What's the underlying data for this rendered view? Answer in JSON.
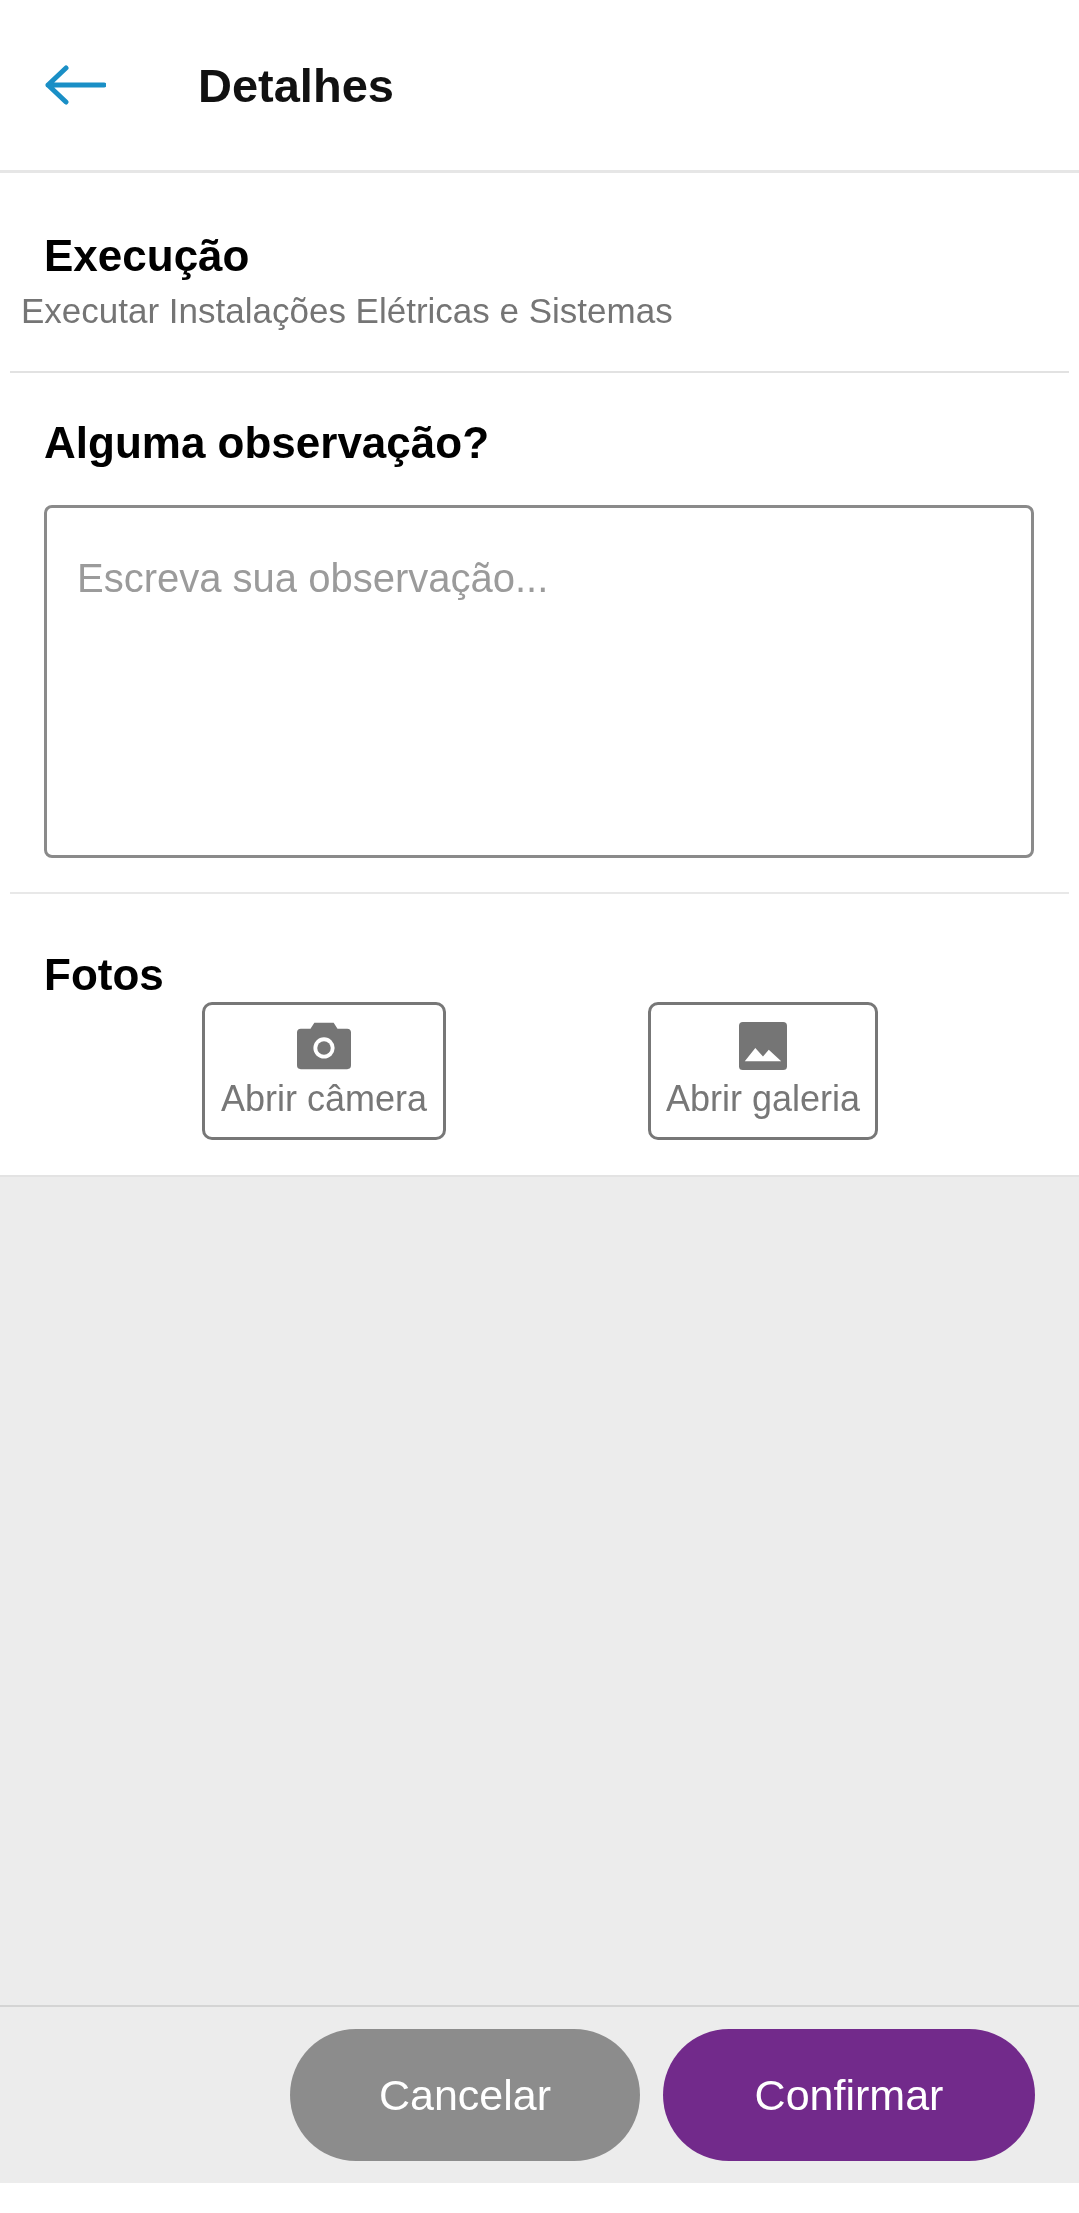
{
  "header": {
    "title": "Detalhes"
  },
  "execution": {
    "title": "Execução",
    "subtitle": "Executar Instalações Elétricas e Sistemas"
  },
  "observation": {
    "title": "Alguma observação?",
    "placeholder": "Escreva sua observação..."
  },
  "photos": {
    "title": "Fotos",
    "buttons": [
      {
        "kind": "camera",
        "label": "Abrir câmera"
      },
      {
        "kind": "gallery",
        "label": "Abrir galeria"
      }
    ]
  },
  "actions": [
    {
      "kind": "secondary",
      "label": "Cancelar"
    },
    {
      "kind": "primary",
      "label": "Confirmar"
    }
  ]
}
